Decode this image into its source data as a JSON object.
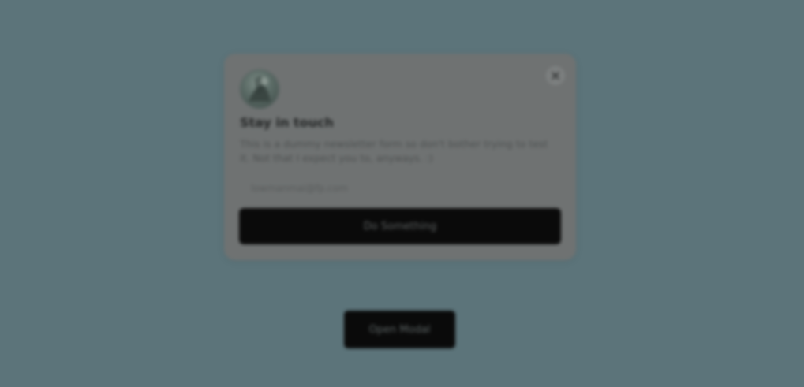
{
  "modal": {
    "title": "Stay in touch",
    "description": "This is a dummy newsletter form so don't bother trying to test it. Not that I expect you to, anyways. :)",
    "email_placeholder": "lowmanmai@fp.com",
    "submit_label": "Do Something",
    "close_icon": "close-icon",
    "avatar_icon": "avatar"
  },
  "page": {
    "open_modal_label": "Open Modal"
  },
  "colors": {
    "background": "#5c747a",
    "modal_background": "#6f7272",
    "button_background": "#0a0a0a"
  }
}
